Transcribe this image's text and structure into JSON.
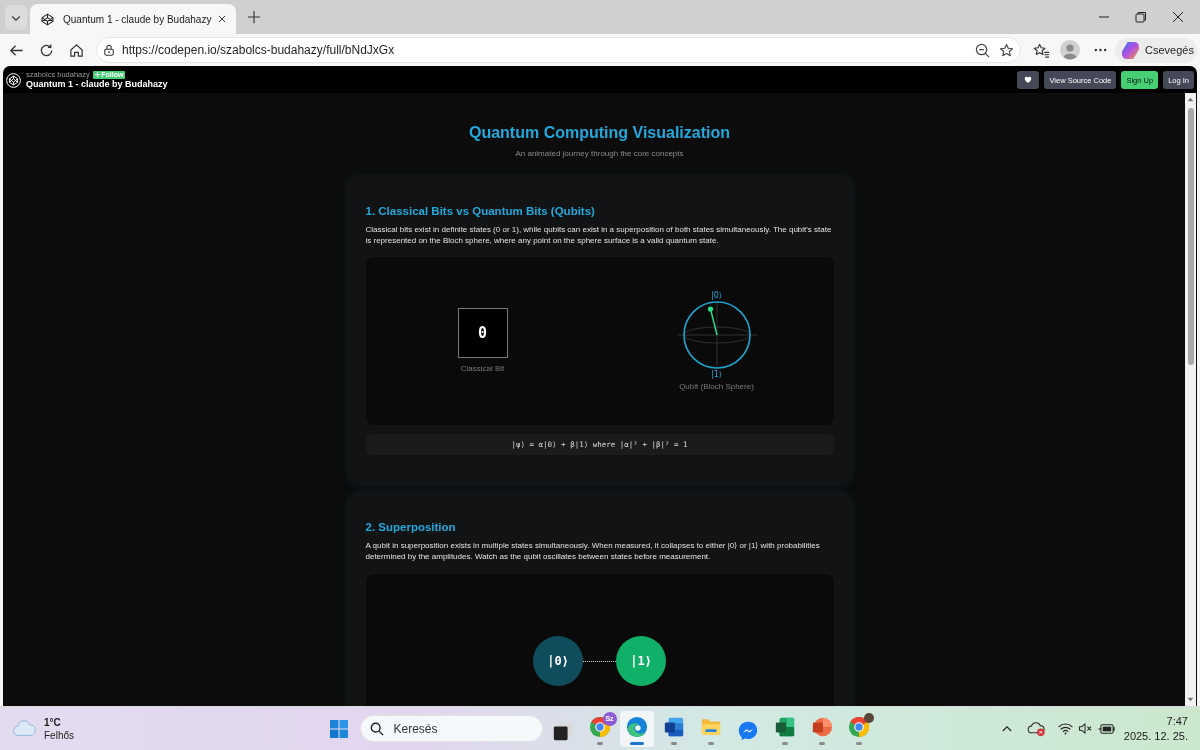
{
  "browser": {
    "tabs": [
      {
        "title": "Quantum 1 - claude by Budahazy",
        "selected": true
      }
    ],
    "url": "https://codepen.io/szabolcs-budahazy/full/bNdJxGx",
    "copilot_label": "Csevegés"
  },
  "pen_header": {
    "author": "szabolcs budahazy",
    "follow_label": "Follow",
    "title": "Quantum 1 - claude by Budahazy",
    "buttons": [
      {
        "kind": "heart"
      },
      {
        "kind": "default",
        "label": "View Source Code"
      },
      {
        "kind": "primary",
        "label": "Sign Up"
      },
      {
        "kind": "default",
        "label": "Log In"
      }
    ]
  },
  "page": {
    "title": "Quantum Computing Visualization",
    "subtitle": "An animated journey through the core concepts",
    "sections": [
      {
        "kind": "bit-vs-qubit",
        "heading": "1. Classical Bits vs Quantum Bits (Qubits)",
        "text": "Classical bits exist in definite states (0 or 1), while qubits can exist in a superposition of both states simultaneously. The qubit's state is represented on the Bloch sphere, where any point on the sphere surface is a valid quantum state.",
        "classical_bit": {
          "value": "0",
          "label": "Classical Bit"
        },
        "qubit": {
          "top_label": "|0⟩",
          "bottom_label": "|1⟩",
          "caption": "Qubit (Bloch Sphere)"
        },
        "equation": "|ψ⟩ = α|0⟩ + β|1⟩ where |α|² + |β|² = 1"
      },
      {
        "kind": "superposition",
        "heading": "2. Superposition",
        "text": "A qubit in superposition exists in multiple states simultaneously. When measured, it collapses to either |0⟩ or |1⟩ with probabilities determined by the amplitudes. Watch as the qubit oscillates between states before measurement.",
        "states": [
          {
            "label": "|0⟩",
            "color": "#0f4c5c"
          },
          {
            "label": "|1⟩",
            "color": "#10b068"
          }
        ]
      }
    ]
  },
  "taskbar": {
    "weather": {
      "temperature": "1°C",
      "condition": "Felhős"
    },
    "search": {
      "placeholder": "Keresés"
    },
    "apps": [
      {
        "kind": "task-view",
        "selected": false,
        "running": false
      },
      {
        "kind": "chrome",
        "selected": false,
        "running": true,
        "badge": "Sz"
      },
      {
        "kind": "edge",
        "selected": true,
        "running": true
      },
      {
        "kind": "word",
        "selected": false,
        "running": true
      },
      {
        "kind": "files",
        "selected": false,
        "running": true
      },
      {
        "kind": "messenger",
        "selected": false,
        "running": false
      },
      {
        "kind": "excel",
        "selected": false,
        "running": true
      },
      {
        "kind": "powerpoint",
        "selected": false,
        "running": true
      },
      {
        "kind": "chrome",
        "selected": false,
        "running": true,
        "avatar_badge": true
      }
    ],
    "tray": {
      "volume_muted": true
    },
    "time": "7:47",
    "date": "2025. 12. 25."
  }
}
